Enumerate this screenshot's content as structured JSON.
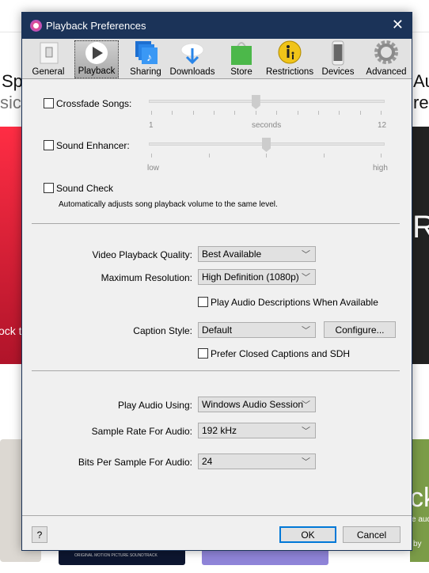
{
  "background": {
    "fragments": [
      "Sp",
      "sic",
      "ock t",
      "Au",
      "re.",
      "R",
      "ck",
      "e aud",
      "by",
      "ORIGINAL MOTION PICTURE SOUNDTRACK"
    ]
  },
  "window": {
    "title": "Playback Preferences",
    "close": "✕"
  },
  "toolbar": {
    "items": [
      {
        "label": "General",
        "icon": "switch-icon"
      },
      {
        "label": "Playback",
        "icon": "play-icon",
        "selected": true
      },
      {
        "label": "Sharing",
        "icon": "music-note-stack-icon"
      },
      {
        "label": "Downloads",
        "icon": "cloud-download-icon"
      },
      {
        "label": "Store",
        "icon": "shopping-bag-icon"
      },
      {
        "label": "Restrictions",
        "icon": "parental-icon"
      },
      {
        "label": "Devices",
        "icon": "phone-icon"
      },
      {
        "label": "Advanced",
        "icon": "gear-icon"
      }
    ]
  },
  "audio": {
    "crossfade": {
      "label": "Crossfade Songs:",
      "checked": false,
      "value_seconds": 6,
      "min_label": "1",
      "mid_label": "seconds",
      "max_label": "12"
    },
    "enhancer": {
      "label": "Sound Enhancer:",
      "checked": false,
      "level": 0.5,
      "min_label": "low",
      "max_label": "high"
    },
    "sound_check": {
      "label": "Sound Check",
      "checked": false,
      "description": "Automatically adjusts song playback volume to the same level."
    }
  },
  "video": {
    "quality": {
      "label": "Video Playback Quality:",
      "value": "Best Available"
    },
    "resolution": {
      "label": "Maximum Resolution:",
      "value": "High Definition (1080p)"
    },
    "audio_descriptions": {
      "label": "Play Audio Descriptions When Available",
      "checked": false
    },
    "caption_style": {
      "label": "Caption Style:",
      "value": "Default",
      "configure": "Configure..."
    },
    "closed_captions": {
      "label": "Prefer Closed Captions and SDH",
      "checked": false
    }
  },
  "output": {
    "play_using": {
      "label": "Play Audio Using:",
      "value": "Windows Audio Session"
    },
    "sample_rate": {
      "label": "Sample Rate For Audio:",
      "value": "192 kHz"
    },
    "bits": {
      "label": "Bits Per Sample For Audio:",
      "value": "24"
    }
  },
  "footer": {
    "help": "?",
    "ok": "OK",
    "cancel": "Cancel"
  },
  "colors": {
    "titlebar": "#1b3358",
    "accent": "#0078d7",
    "red_banner": "#e8243a"
  }
}
